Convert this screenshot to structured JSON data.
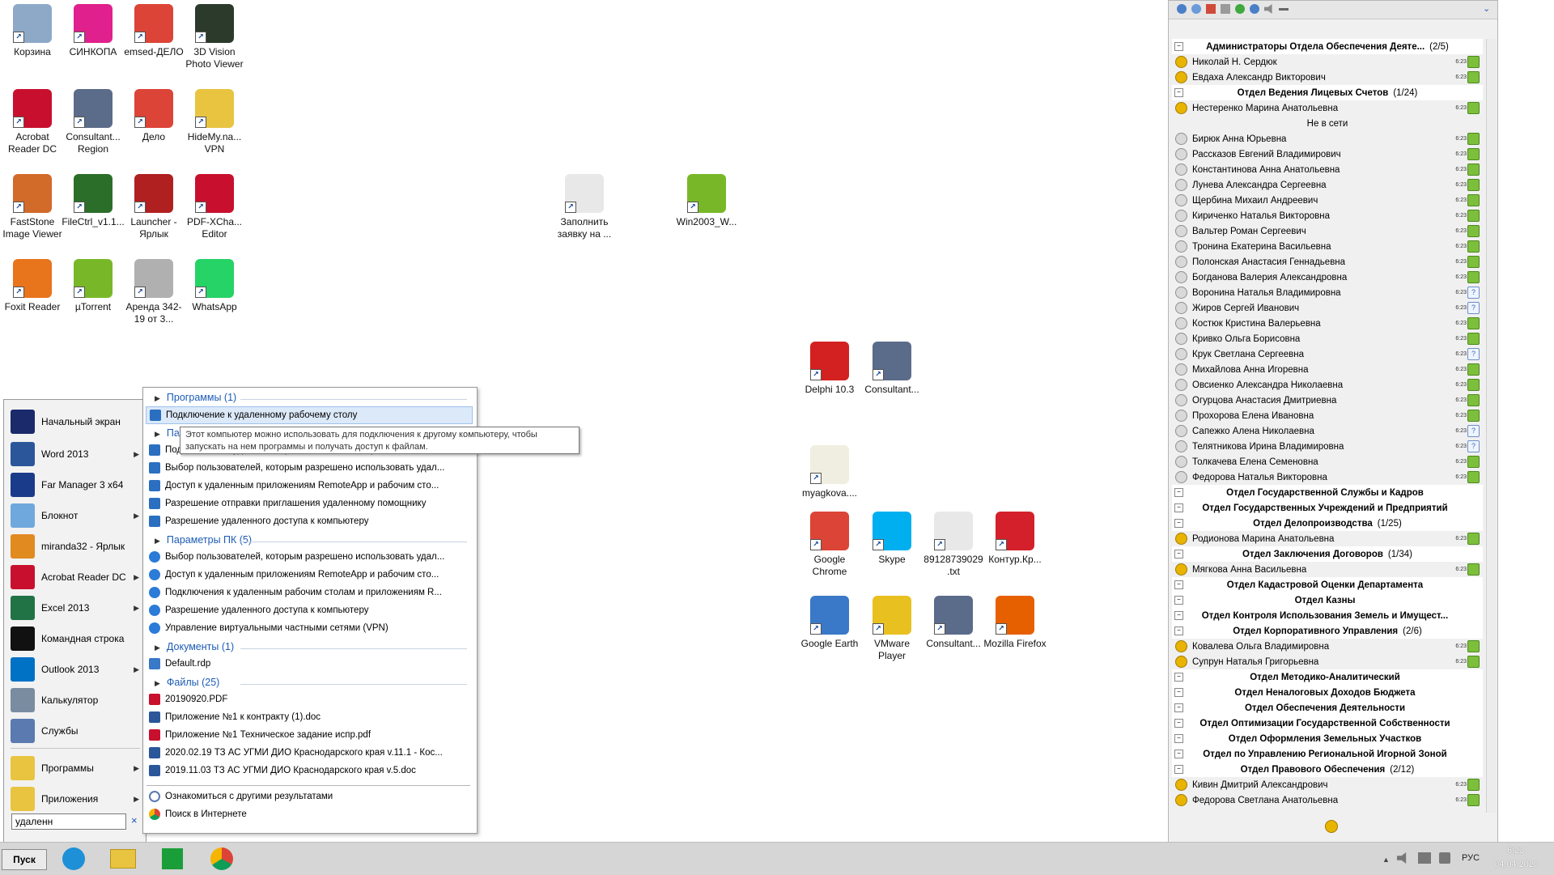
{
  "desktop_icons": [
    {
      "label": "Корзина",
      "color": "#8ea9c8"
    },
    {
      "label": "СИНКОПА",
      "color": "#e0208c"
    },
    {
      "label": "emsed-ДЕЛО",
      "color": "#db4437"
    },
    {
      "label": "3D Vision Photo Viewer",
      "color": "#2b3a2b"
    },
    {
      "label": "Acrobat Reader DC",
      "color": "#c8102e"
    },
    {
      "label": "Consultant... Region",
      "color": "#5b6b8a"
    },
    {
      "label": "Дело",
      "color": "#db4437"
    },
    {
      "label": "HideMy.na... VPN",
      "color": "#e8c440"
    },
    {
      "label": "FastStone Image Viewer",
      "color": "#d26a2a"
    },
    {
      "label": "FileCtrl_v1.1...",
      "color": "#2a6e2a"
    },
    {
      "label": "Launcher - Ярлык",
      "color": "#b02020"
    },
    {
      "label": "PDF-XCha... Editor",
      "color": "#c8102e"
    },
    {
      "label": "Foxit Reader",
      "color": "#e8741c"
    },
    {
      "label": "µTorrent",
      "color": "#78b828"
    },
    {
      "label": "Аренда 342-19 от 3...",
      "color": "#b0b0b0"
    },
    {
      "label": "WhatsApp",
      "color": "#25d366"
    },
    {
      "label": "Заполнить заявку на ...",
      "color": "#e8e8e8"
    },
    {
      "label": "Win2003_W...",
      "color": "#78b828"
    },
    {
      "label": "Delphi 10.3",
      "color": "#d32020"
    },
    {
      "label": "Consultant...",
      "color": "#5b6b8a"
    },
    {
      "label": "myagkova....",
      "color": "#f0eee0"
    },
    {
      "label": "Google Chrome",
      "color": "#db4437"
    },
    {
      "label": "Skype",
      "color": "#00aff0"
    },
    {
      "label": "89128739029 .txt",
      "color": "#e8e8e8"
    },
    {
      "label": "Контур.Кр...",
      "color": "#d4202a"
    },
    {
      "label": "Google Earth",
      "color": "#3a78c8"
    },
    {
      "label": "VMware Player",
      "color": "#e8c020"
    },
    {
      "label": "Consultant...",
      "color": "#5b6b8a"
    },
    {
      "label": "Mozilla Firefox",
      "color": "#e66000"
    }
  ],
  "start_menu": {
    "items": [
      {
        "label": "Начальный экран",
        "arrow": false,
        "color": "#1b2a6b"
      },
      {
        "label": "Word 2013",
        "arrow": true,
        "color": "#2b579a"
      },
      {
        "label": "Far Manager 3 x64",
        "arrow": false,
        "color": "#1a3a8a"
      },
      {
        "label": "Блокнот",
        "arrow": true,
        "color": "#6fa8dc"
      },
      {
        "label": "miranda32 - Ярлык",
        "arrow": false,
        "color": "#e08a20"
      },
      {
        "label": "Acrobat Reader DC",
        "arrow": true,
        "color": "#c8102e"
      },
      {
        "label": "Excel 2013",
        "arrow": true,
        "color": "#217346"
      },
      {
        "label": "Командная строка",
        "arrow": false,
        "color": "#111111"
      },
      {
        "label": "Outlook 2013",
        "arrow": true,
        "color": "#0072c6"
      },
      {
        "label": "Калькулятор",
        "arrow": false,
        "color": "#7a8ca0"
      },
      {
        "label": "Службы",
        "arrow": false,
        "color": "#5a7ab0"
      },
      {
        "label": "Программы",
        "arrow": true,
        "color": "#e8c440"
      },
      {
        "label": "Приложения",
        "arrow": true,
        "color": "#e8c440"
      }
    ],
    "search_value": "удаленн",
    "clear_label": "×"
  },
  "results": {
    "groups": [
      {
        "header": "Программы (1)",
        "items": [
          {
            "label": "Подключение к удаленному рабочему столу",
            "selected": true
          }
        ]
      },
      {
        "header": "Пар",
        "items": [
          {
            "label": "Подключения к удаленным рабочим столам и приложениям R..."
          },
          {
            "label": "Выбор пользователей, которым разрешено использовать удал..."
          },
          {
            "label": "Доступ к удаленным приложениям RemoteApp и рабочим сто..."
          },
          {
            "label": "Разрешение отправки приглашения удаленному помощнику"
          },
          {
            "label": "Разрешение удаленного доступа к компьютеру"
          }
        ]
      },
      {
        "header": "Параметры ПК (5)",
        "items": [
          {
            "label": "Выбор пользователей, которым разрешено использовать удал..."
          },
          {
            "label": "Доступ к удаленным приложениям RemoteApp и рабочим сто..."
          },
          {
            "label": "Подключения к удаленным рабочим столам и приложениям R..."
          },
          {
            "label": "Разрешение удаленного доступа к компьютеру"
          },
          {
            "label": "Управление виртуальными частными сетями (VPN)"
          }
        ]
      },
      {
        "header": "Документы (1)",
        "items": [
          {
            "label": "Default.rdp"
          }
        ]
      },
      {
        "header": "Файлы (25)",
        "items": [
          {
            "label": "20190920.PDF"
          },
          {
            "label": "Приложение №1 к контракту (1).doc"
          },
          {
            "label": "Приложение №1 Техническое задание испр.pdf"
          },
          {
            "label": "2020.02.19 ТЗ АС УГМИ ДИО Краснодарского края  v.11.1 - Кос..."
          },
          {
            "label": "2019.11.03 ТЗ АС УГМИ ДИО Краснодарского края v.5.doc"
          }
        ]
      }
    ],
    "footer": [
      {
        "label": "Ознакомиться с другими результатами"
      },
      {
        "label": "Поиск в Интернете"
      }
    ],
    "tooltip": "Этот компьютер можно использовать для подключения к другому компьютеру, чтобы запускать на нем программы и получать доступ к файлам."
  },
  "taskbar": {
    "start_label": "Пуск",
    "lang": "РУС",
    "time": "6:23",
    "date": "04.04.2020"
  },
  "miranda": {
    "rows": [
      {
        "type": "group",
        "label": "Администраторы Отдела Обеспечения Деяте...",
        "count": "(2/5)"
      },
      {
        "type": "contact",
        "label": "Николай Н. Сердюк",
        "online": true,
        "q": false
      },
      {
        "type": "contact",
        "label": "Евдаха Александр Викторович",
        "online": true,
        "q": false
      },
      {
        "type": "group",
        "label": "Отдел Ведения Лицевых Счетов",
        "count": "(1/24)"
      },
      {
        "type": "contact",
        "label": "Нестеренко Марина Анатольевна",
        "online": true,
        "q": false
      },
      {
        "type": "divider",
        "label": "Не в сети"
      },
      {
        "type": "contact",
        "label": "Бирюк Анна Юрьевна",
        "online": false,
        "q": false
      },
      {
        "type": "contact",
        "label": "Рассказов Евгений Владимирович",
        "online": false,
        "q": false
      },
      {
        "type": "contact",
        "label": "Константинова Анна Анатольевна",
        "online": false,
        "q": false
      },
      {
        "type": "contact",
        "label": "Лунева Александра Сергеевна",
        "online": false,
        "q": false
      },
      {
        "type": "contact",
        "label": "Щербина Михаил Андреевич",
        "online": false,
        "q": false
      },
      {
        "type": "contact",
        "label": "Кириченко Наталья Викторовна",
        "online": false,
        "q": false
      },
      {
        "type": "contact",
        "label": "Вальтер Роман Сергеевич",
        "online": false,
        "q": false
      },
      {
        "type": "contact",
        "label": "Тронина Екатерина Васильевна",
        "online": false,
        "q": false
      },
      {
        "type": "contact",
        "label": "Полонская Анастасия Геннадьевна",
        "online": false,
        "q": false
      },
      {
        "type": "contact",
        "label": "Богданова Валерия Александровна",
        "online": false,
        "q": false
      },
      {
        "type": "contact",
        "label": "Воронина Наталья Владимировна",
        "online": false,
        "q": true
      },
      {
        "type": "contact",
        "label": "Жиров Сергей Иванович",
        "online": false,
        "q": true
      },
      {
        "type": "contact",
        "label": "Костюк Кристина Валерьевна",
        "online": false,
        "q": false
      },
      {
        "type": "contact",
        "label": "Кривко Ольга Борисовна",
        "online": false,
        "q": false
      },
      {
        "type": "contact",
        "label": "Крук Светлана Сергеевна",
        "online": false,
        "q": true
      },
      {
        "type": "contact",
        "label": "Михайлова Анна Игоревна",
        "online": false,
        "q": false
      },
      {
        "type": "contact",
        "label": "Овсиенко Александра Николаевна",
        "online": false,
        "q": false
      },
      {
        "type": "contact",
        "label": "Огурцова Анастасия Дмитриевна",
        "online": false,
        "q": false
      },
      {
        "type": "contact",
        "label": "Прохорова Елена Ивановна",
        "online": false,
        "q": false
      },
      {
        "type": "contact",
        "label": "Сапежко Алена Николаевна",
        "online": false,
        "q": true
      },
      {
        "type": "contact",
        "label": "Телятникова Ирина Владимировна",
        "online": false,
        "q": true
      },
      {
        "type": "contact",
        "label": "Толкачева Елена Семеновна",
        "online": false,
        "q": false
      },
      {
        "type": "contact",
        "label": "Федорова Наталья Викторовна",
        "online": false,
        "q": false
      },
      {
        "type": "group",
        "label": "Отдел Государственной Службы и Кадров",
        "count": ""
      },
      {
        "type": "group",
        "label": "Отдел Государственных Учреждений и Предприятий",
        "count": ""
      },
      {
        "type": "group",
        "label": "Отдел Делопроизводства",
        "count": "(1/25)"
      },
      {
        "type": "contact",
        "label": "Родионова Марина Анатольевна",
        "online": true,
        "q": false
      },
      {
        "type": "group",
        "label": "Отдел Заключения Договоров",
        "count": "(1/34)"
      },
      {
        "type": "contact",
        "label": "Мягкова Анна Васильевна",
        "online": true,
        "q": false
      },
      {
        "type": "group",
        "label": "Отдел Кадастровой Оценки Департамента",
        "count": ""
      },
      {
        "type": "group",
        "label": "Отдел Казны",
        "count": ""
      },
      {
        "type": "group",
        "label": "Отдел Контроля Использования Земель и Имущест...",
        "count": ""
      },
      {
        "type": "group",
        "label": "Отдел Корпоративного Управления",
        "count": "(2/6)"
      },
      {
        "type": "contact",
        "label": "Ковалева Ольга Владимировна",
        "online": true,
        "q": false
      },
      {
        "type": "contact",
        "label": "Супрун Наталья Григорьевна",
        "online": true,
        "q": false
      },
      {
        "type": "group",
        "label": "Отдел Методико-Аналитический",
        "count": ""
      },
      {
        "type": "group",
        "label": "Отдел Неналоговых Доходов Бюджета",
        "count": ""
      },
      {
        "type": "group",
        "label": "Отдел Обеспечения Деятельности",
        "count": ""
      },
      {
        "type": "group",
        "label": "Отдел Оптимизации Государственной Собственности",
        "count": ""
      },
      {
        "type": "group",
        "label": "Отдел Оформления Земельных Участков",
        "count": ""
      },
      {
        "type": "group",
        "label": "Отдел по Управлению Региональной Игорной Зоной",
        "count": ""
      },
      {
        "type": "group",
        "label": "Отдел Правового Обеспечения",
        "count": "(2/12)"
      },
      {
        "type": "contact",
        "label": "Кивин Дмитрий Александрович",
        "online": true,
        "q": false
      },
      {
        "type": "contact",
        "label": "Федорова Светлана Анатольевна",
        "online": true,
        "q": false
      }
    ],
    "contact_time": "6:23"
  }
}
